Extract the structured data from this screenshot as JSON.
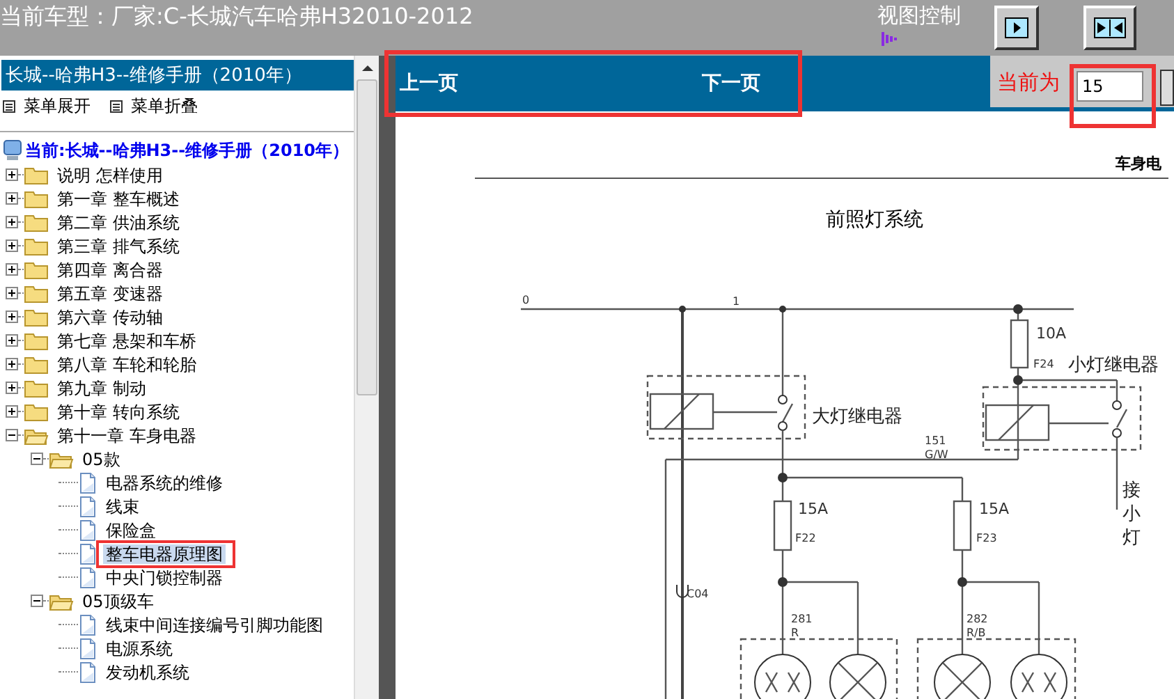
{
  "header": {
    "title": "当前车型：厂家:C-长城汽车哈弗H32010-2012",
    "view_control_label": "视图控制"
  },
  "sidebar": {
    "manual_title": "长城--哈弗H3--维修手册（2010年）",
    "expand_all": "菜单展开",
    "collapse_all": "菜单折叠",
    "current": "当前:长城--哈弗H3--维修手册（2010年）",
    "tree": [
      {
        "label": "说明 怎样使用",
        "kind": "folder",
        "expanded": false,
        "selected": false
      },
      {
        "label": "第一章 整车概述",
        "kind": "folder",
        "expanded": false,
        "selected": false
      },
      {
        "label": "第二章 供油系统",
        "kind": "folder",
        "expanded": false,
        "selected": false
      },
      {
        "label": "第三章 排气系统",
        "kind": "folder",
        "expanded": false,
        "selected": false
      },
      {
        "label": "第四章 离合器",
        "kind": "folder",
        "expanded": false,
        "selected": false
      },
      {
        "label": "第五章 变速器",
        "kind": "folder",
        "expanded": false,
        "selected": false
      },
      {
        "label": "第六章 传动轴",
        "kind": "folder",
        "expanded": false,
        "selected": false
      },
      {
        "label": "第七章 悬架和车桥",
        "kind": "folder",
        "expanded": false,
        "selected": false
      },
      {
        "label": "第八章 车轮和轮胎",
        "kind": "folder",
        "expanded": false,
        "selected": false
      },
      {
        "label": "第九章 制动",
        "kind": "folder",
        "expanded": false,
        "selected": false
      },
      {
        "label": "第十章 转向系统",
        "kind": "folder",
        "expanded": false,
        "selected": false
      },
      {
        "label": "第十一章 车身电器",
        "kind": "folder",
        "expanded": true,
        "selected": false,
        "children": [
          {
            "label": "05款",
            "kind": "folder",
            "expanded": true,
            "selected": false,
            "children": [
              {
                "label": "电器系统的维修",
                "kind": "page",
                "selected": false
              },
              {
                "label": "线束",
                "kind": "page",
                "selected": false
              },
              {
                "label": "保险盒",
                "kind": "page",
                "selected": false
              },
              {
                "label": "整车电器原理图",
                "kind": "page",
                "selected": true
              },
              {
                "label": "中央门锁控制器",
                "kind": "page",
                "selected": false
              }
            ]
          },
          {
            "label": "05顶级车",
            "kind": "folder",
            "expanded": true,
            "selected": false,
            "children": [
              {
                "label": "线束中间连接编号引脚功能图",
                "kind": "page",
                "selected": false
              },
              {
                "label": "电源系统",
                "kind": "page",
                "selected": false
              },
              {
                "label": "发动机系统",
                "kind": "page",
                "selected": false
              }
            ]
          }
        ]
      }
    ]
  },
  "pager": {
    "previous": "上一页",
    "next": "下一页",
    "current_label": "当前为",
    "page": "15"
  },
  "document": {
    "header": "车身电",
    "title": "前照灯系统",
    "diagram_labels": [
      "0",
      "1",
      "10A",
      "F24",
      "小灯继电器",
      "大灯继电器",
      "151",
      "G/W",
      "15A",
      "F22",
      "15A",
      "F23",
      "接小灯",
      "C04",
      "281",
      "R",
      "282",
      "R/B"
    ]
  }
}
